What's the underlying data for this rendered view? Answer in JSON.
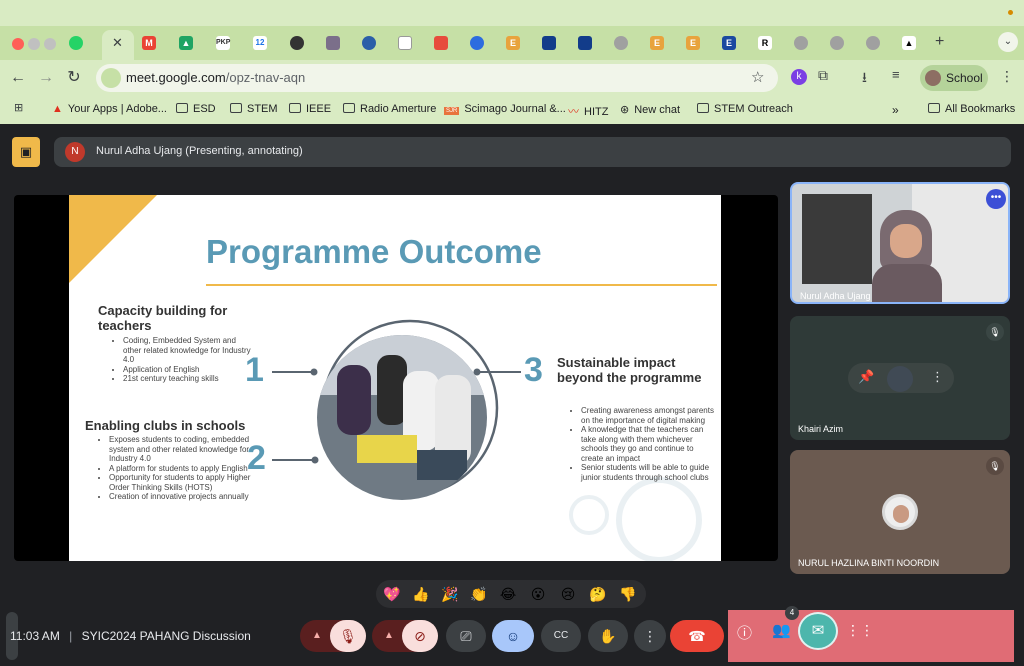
{
  "browser": {
    "url_host": "meet.google.com",
    "url_path": "/opz-tnav-aqn",
    "profile_label": "School",
    "tab_letters": [
      "",
      "",
      "",
      "PKP",
      "12",
      "",
      "",
      "",
      "",
      "",
      "",
      "E",
      "",
      "",
      "E",
      "E",
      "E",
      "R",
      "",
      "",
      "",
      ""
    ],
    "bookmarks": [
      {
        "label": "Your Apps | Adobe..."
      },
      {
        "label": "ESD"
      },
      {
        "label": "STEM"
      },
      {
        "label": "IEEE"
      },
      {
        "label": "Radio Amerture"
      },
      {
        "label": "Scimago Journal &..."
      },
      {
        "label": "HITZ"
      },
      {
        "label": "New chat"
      },
      {
        "label": "STEM Outreach"
      },
      {
        "label": "All Bookmarks"
      }
    ],
    "overflow_label": "»"
  },
  "meet": {
    "presenter_initial": "N",
    "presenter_banner": "Nurul Adha Ujang (Presenting, annotating)",
    "slide": {
      "title": "Programme Outcome",
      "sec1_title": "Capacity building for teachers",
      "sec1_items": [
        "Coding, Embedded System and other related knowledge for Industry 4.0",
        "Application of English",
        "21st century teaching skills"
      ],
      "sec2_title": "Enabling clubs in schools",
      "sec2_items": [
        "Exposes students to coding, embedded system and other related knowledge for Industry 4.0",
        "A platform for students to apply English",
        "Opportunity for students to apply Higher Order Thinking Skills (HOTS)",
        "Creation of innovative projects annually"
      ],
      "sec3_title": "Sustainable impact beyond the programme",
      "sec3_items": [
        "Creating awareness amongst parents on the importance of digital making",
        "A knowledge that the teachers can take along with them whichever schools they go and continue to create an impact",
        "Senior students will be able to guide junior students through school clubs"
      ],
      "num1": "1",
      "num2": "2",
      "num3": "3"
    },
    "participants": [
      {
        "name": "Nurul Adha Ujang",
        "muted": false
      },
      {
        "name": "Khairi Azim",
        "muted": true
      },
      {
        "name": "NURUL HAZLINA BINTI NOORDIN",
        "muted": true
      }
    ],
    "reactions": [
      "💖",
      "👍",
      "🎉",
      "👏",
      "😂",
      "😮",
      "😢",
      "🤔",
      "👎"
    ],
    "time": "11:03 AM",
    "meeting_title": "SYIC2024 PAHANG Discussion",
    "people_count": "4",
    "colors": {
      "accent": "#5a9ab5",
      "gold": "#f0b94a",
      "end_call": "#ea4335",
      "panel_highlight": "#e06c75"
    }
  }
}
